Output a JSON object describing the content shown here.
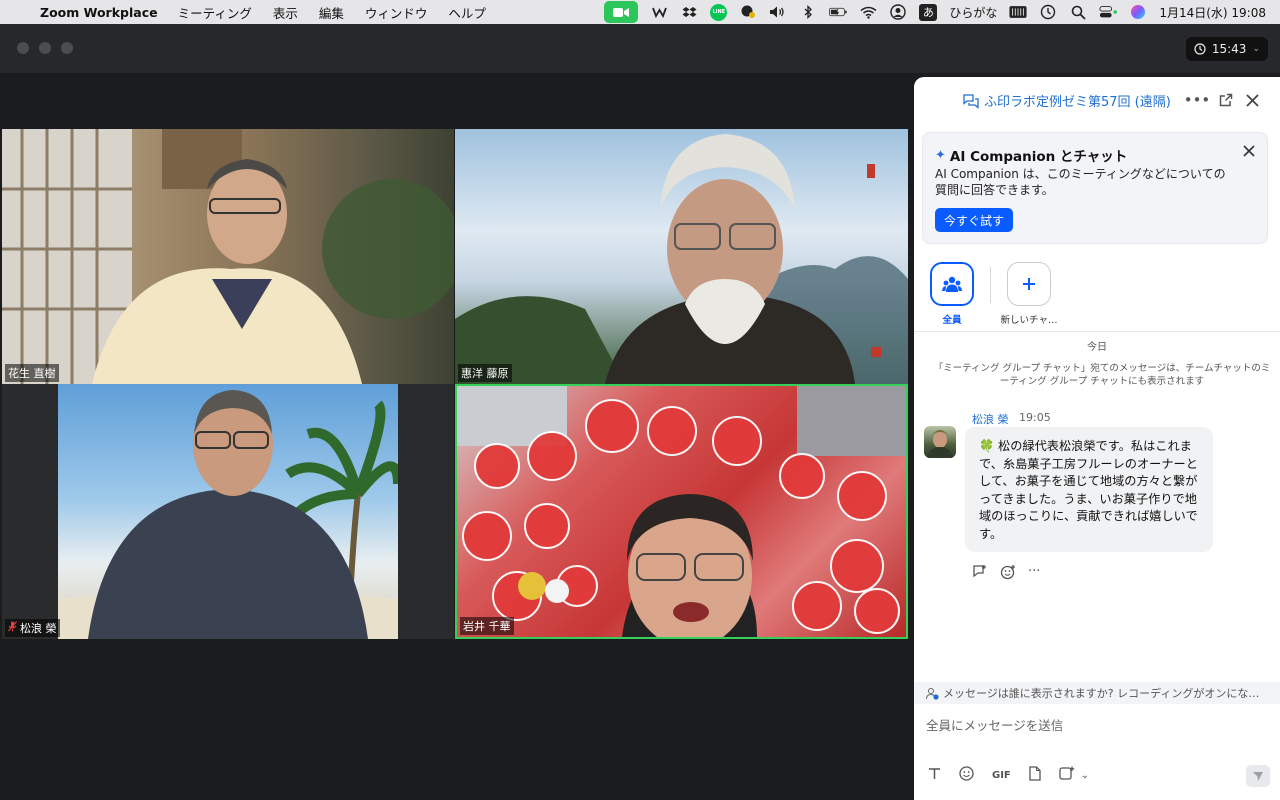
{
  "menubar": {
    "app_name": "Zoom Workplace",
    "menus": [
      "ミーティング",
      "表示",
      "編集",
      "ウィンドウ",
      "ヘルプ"
    ],
    "line_label": "LINE",
    "ime_box": "あ",
    "ime_label": "ひらがな",
    "datetime": "1月14日(水) 19:08"
  },
  "window": {
    "timer": "15:43"
  },
  "videos": [
    {
      "name": "花生 直樹",
      "muted": false
    },
    {
      "name": "惠洋 藤原",
      "muted": false
    },
    {
      "name": "松浪 榮",
      "muted": true
    },
    {
      "name": "岩井 千華",
      "muted": false,
      "active_speaker": true
    }
  ],
  "chat": {
    "title": "ふ印ラボ定例ゼミ第57回 (遠隔)",
    "ai_card": {
      "title": "AI Companion とチャット",
      "description": "AI Companion は、このミーティングなどについての質問に回答できます。",
      "button": "今すぐ試す"
    },
    "recipients": {
      "everyone": "全員",
      "new_chat": "新しいチャ…"
    },
    "day_label": "今日",
    "system_message": "「ミーティング グループ チャット」宛てのメッセージは、チームチャットのミーティング グループ チャットにも表示されます",
    "message": {
      "sender": "松浪 榮",
      "time": "19:05",
      "text": "🍀 松の緑代表松浪榮です。私はこれまで、糸島菓子工房フルーレのオーナーとして、お菓子を通じて地域の方々と繋がってきました。うま、いお菓子作りで地域のほっこりに、貢献できれば嬉しいです。"
    },
    "notice": "メッセージは誰に表示されますか? レコーディングがオンにな…",
    "compose_placeholder": "全員にメッセージを送信",
    "toolbar": {
      "gif_label": "GIF"
    }
  }
}
